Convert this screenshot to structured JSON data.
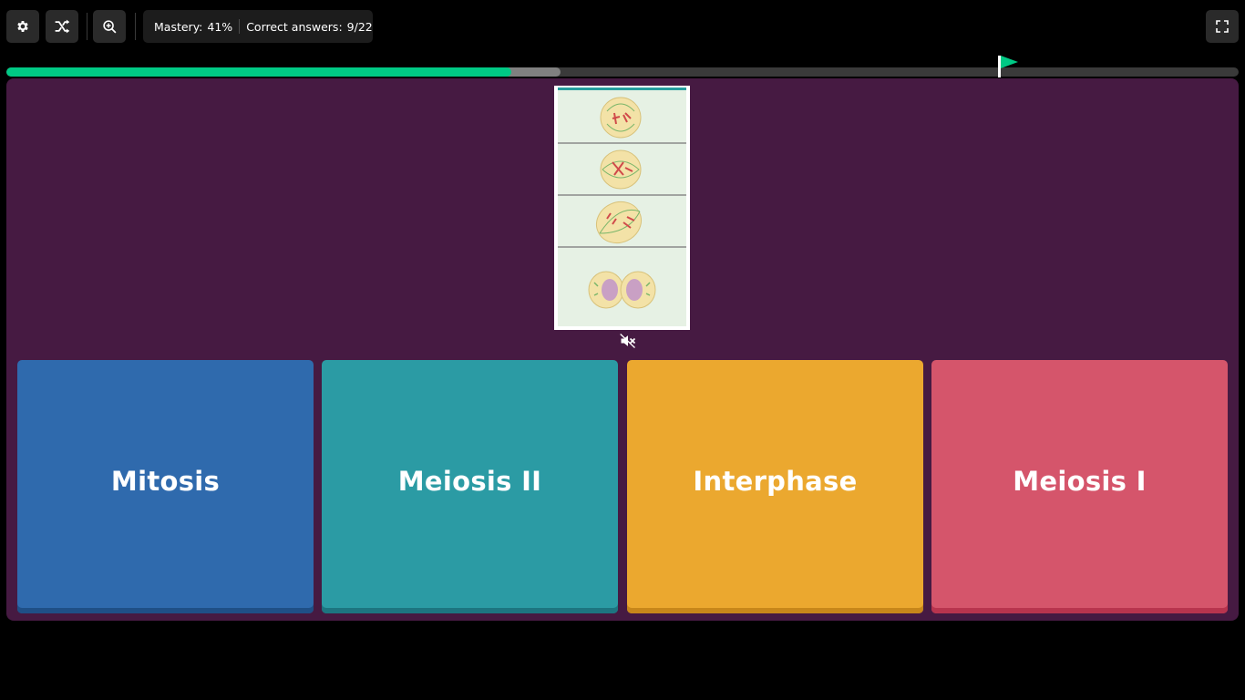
{
  "toolbar": {
    "settings_icon": "gear-icon",
    "powerups_icon": "shuffle-arrows-icon",
    "zoom_icon": "zoom-in-icon",
    "fullscreen_icon": "fullscreen-icon"
  },
  "stats": {
    "mastery_label": "Mastery:",
    "mastery_value": "41%",
    "correct_label": "Correct answers:",
    "correct_value": "9/22"
  },
  "progress": {
    "correct_fraction": 0.41,
    "attempted_fraction": 0.45,
    "flag_fraction": 0.805,
    "colors": {
      "correct": "#00c985",
      "attempted": "#808080",
      "track": "#3a3a3a"
    }
  },
  "question": {
    "image_icon": "cell-division-stages-image",
    "audio_icon": "muted-speaker-icon"
  },
  "options": [
    {
      "label": "Mitosis",
      "color": "#2f6aad",
      "shade": "#1f4f86"
    },
    {
      "label": "Meiosis II",
      "color": "#2b9ba4",
      "shade": "#1d7580"
    },
    {
      "label": "Interphase",
      "color": "#eba82f",
      "shade": "#c7861a"
    },
    {
      "label": "Meiosis I",
      "color": "#d5556b",
      "shade": "#b8344e"
    }
  ]
}
